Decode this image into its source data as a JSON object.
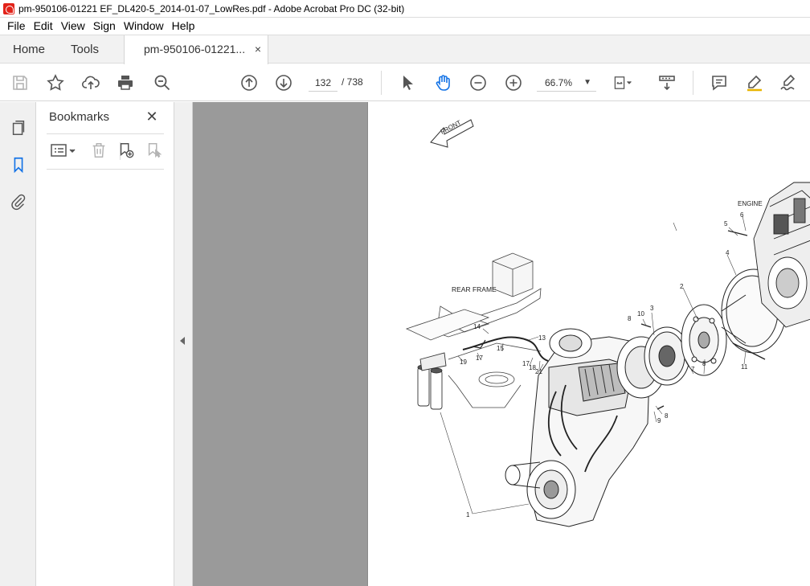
{
  "window": {
    "title": "pm-950106-01221 EF_DL420-5_2014-01-07_LowRes.pdf - Adobe Acrobat Pro DC (32-bit)"
  },
  "menu": [
    "File",
    "Edit",
    "View",
    "Sign",
    "Window",
    "Help"
  ],
  "tabs": {
    "home": "Home",
    "tools": "Tools",
    "document": "pm-950106-01221...",
    "close_symbol": "×"
  },
  "toolbar": {
    "icons": [
      "save-icon",
      "star-icon",
      "upload-icon",
      "print-icon",
      "search-zoom-icon",
      "page-up-icon",
      "page-down-icon",
      "select-cursor-icon",
      "hand-tool-icon",
      "zoom-out-icon",
      "zoom-in-icon",
      "page-fit-icon",
      "scroll-mode-icon",
      "comment-icon",
      "highlight-icon",
      "sign-icon"
    ],
    "page_current": "132",
    "page_total": "/ 738",
    "zoom": "66.7%",
    "accent_color": "#1473e6"
  },
  "sidebar": {
    "rail_icons": [
      "pages-icon",
      "bookmark-icon",
      "attachment-icon"
    ],
    "active": "bookmark-icon"
  },
  "bookmarks_panel": {
    "title": "Bookmarks",
    "close_symbol": "✕",
    "tools": [
      "options-list-icon",
      "delete-bookmark-icon",
      "new-bookmark-icon",
      "bookmark-from-selection-icon"
    ]
  },
  "drawing": {
    "front_label": "FRONT",
    "rear_frame_label": "REAR FRAME",
    "engine_label": "ENGINE",
    "callouts": [
      "1",
      "2",
      "3",
      "4",
      "5",
      "6",
      "7",
      "8",
      "8",
      "8",
      "9",
      "10",
      "11",
      "13",
      "14",
      "15",
      "17",
      "17",
      "18",
      "19",
      "21"
    ]
  }
}
